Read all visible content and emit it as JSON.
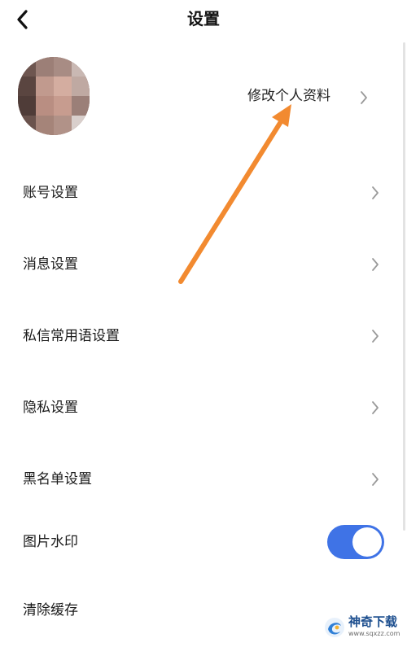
{
  "header": {
    "title": "设置",
    "back_icon": "chevron-left-icon"
  },
  "profile": {
    "edit_label": "修改个人资料",
    "chevron_icon": "chevron-right-icon"
  },
  "menu": [
    {
      "label": "账号设置",
      "icon": "chevron-right-icon"
    },
    {
      "label": "消息设置",
      "icon": "chevron-right-icon"
    },
    {
      "label": "私信常用语设置",
      "icon": "chevron-right-icon"
    },
    {
      "label": "隐私设置",
      "icon": "chevron-right-icon"
    },
    {
      "label": "黑名单设置",
      "icon": "chevron-right-icon"
    }
  ],
  "watermark_toggle": {
    "label": "图片水印",
    "on": true
  },
  "clear_cache": {
    "label": "清除缓存"
  },
  "overlay": {
    "brand_text": "神奇下载",
    "brand_url": "www.sqxzz.com"
  },
  "colors": {
    "toggle_on": "#3f73e6",
    "arrow": "#f28a30"
  }
}
